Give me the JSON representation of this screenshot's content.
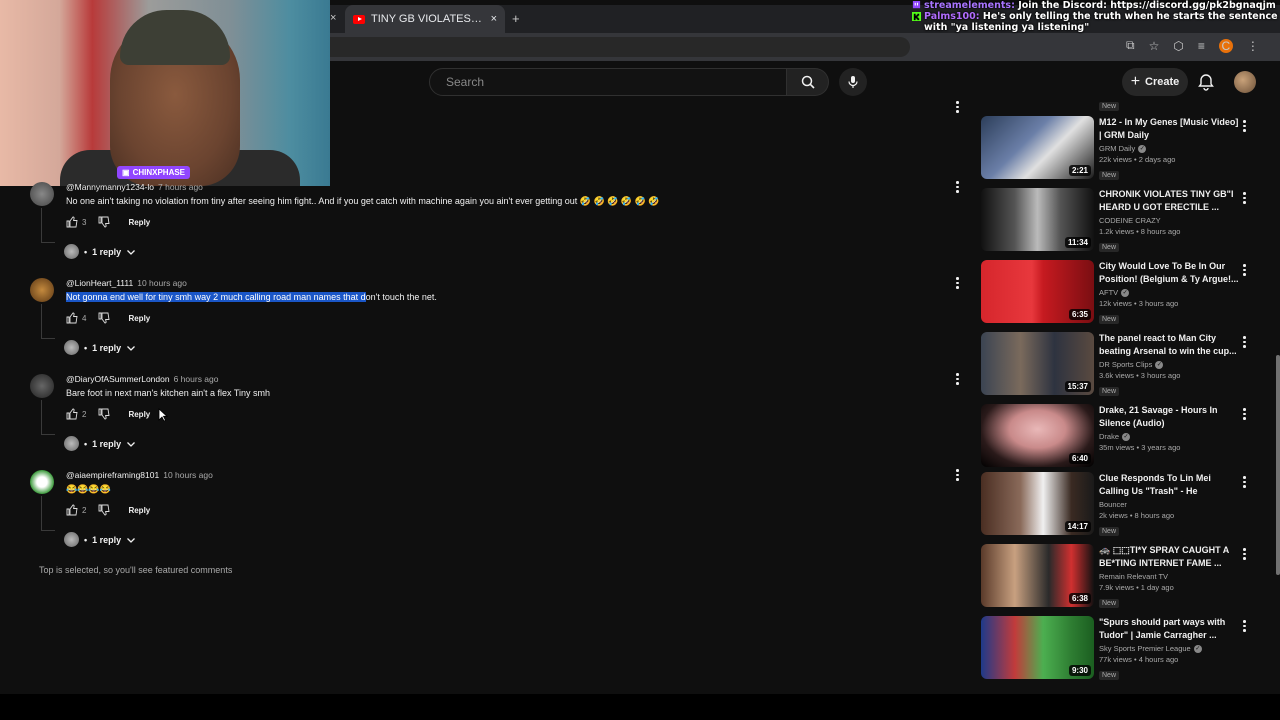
{
  "browser": {
    "tab_title": "TINY GB VIOLATES JUSTO,PINK",
    "tab_close": "×",
    "new_tab": "+",
    "profile_initial": "C"
  },
  "chat_overlay": {
    "messages": [
      {
        "user": "streamelements:",
        "text": "Join the Discord: https://discord.gg/pk2bgnaqjm"
      },
      {
        "user": "Palms100:",
        "text": "He's only telling the truth when he starts the sentence with \"ya listening ya listening\""
      }
    ]
  },
  "webcam": {
    "tag": "CHINXPHASE"
  },
  "masthead": {
    "search_placeholder": "Search",
    "create_label": "Create"
  },
  "comments": [
    {
      "author": "@Mannymanny1234-lo",
      "ago": "7 hours ago",
      "text": "No one ain't taking no violation from tiny after seeing him fight.. And if you get catch with machine again you ain't ever getting out 🤣 🤣 🤣 🤣 🤣 🤣",
      "likes": "3",
      "reply_label": "Reply",
      "replies_label": "1 reply"
    },
    {
      "author": "@LionHeart_1111",
      "ago": "10 hours ago",
      "text_highlighted": "Not gonna end well for tiny smh way 2 much calling road man names that d",
      "text_rest": "on't touch the net.",
      "likes": "4",
      "reply_label": "Reply",
      "replies_label": "1 reply"
    },
    {
      "author": "@DiaryOfASummerLondon",
      "ago": "6 hours ago",
      "text": "Bare foot in next man's kitchen ain't a flex Tiny smh",
      "likes": "2",
      "reply_label": "Reply",
      "replies_label": "1 reply"
    },
    {
      "author": "@aiaempireframing8101",
      "ago": "10 hours ago",
      "text": "😂😂😂😂",
      "likes": "2",
      "reply_label": "Reply",
      "replies_label": "1 reply"
    }
  ],
  "featured_note": "Top is selected, so you'll see featured comments",
  "sidebar": {
    "top_new": "New",
    "videos": [
      {
        "title": "M12 - In My Genes [Music Video] | GRM Daily",
        "channel": "GRM Daily",
        "verified": true,
        "meta": "22k views • 2 days ago",
        "badge": "New",
        "duration": "2:21"
      },
      {
        "title": "CHRONIK VIOLATES TINY GB\"I HEARD U GOT ERECTILE ...",
        "channel": "CODEINE CRAZY",
        "verified": false,
        "meta": "1.2k views • 8 hours ago",
        "badge": "New",
        "duration": "11:34"
      },
      {
        "title": "City Would Love To Be In Our Position! (Belgium & Ty Argue!...",
        "channel": "AFTV",
        "verified": true,
        "meta": "12k views • 3 hours ago",
        "badge": "New",
        "duration": "6:35"
      },
      {
        "title": "The panel react to Man City beating Arsenal to win the cup...",
        "channel": "DR Sports Clips",
        "verified": true,
        "meta": "3.6k views • 3 hours ago",
        "badge": "New",
        "duration": "15:37"
      },
      {
        "title": "Drake, 21 Savage - Hours In Silence (Audio)",
        "channel": "Drake",
        "verified": true,
        "meta": "35m views • 3 years ago",
        "badge": "",
        "duration": "6:40"
      },
      {
        "title": "Clue Responds To Lin Mei Calling Us \"Trash\" - He Doesn't...",
        "channel": "Bouncer",
        "verified": false,
        "meta": "2k views • 8 hours ago",
        "badge": "New",
        "duration": "14:17"
      },
      {
        "title": "🚓 ⬚⬚TI*Y SPRAY CAUGHT A BE*TING  INTERNET FAME ...",
        "channel": "Remain Relevant TV",
        "verified": false,
        "meta": "7.9k views • 1 day ago",
        "badge": "New",
        "duration": "6:38"
      },
      {
        "title": "\"Spurs should part ways with Tudor\" | Jamie Carragher ...",
        "channel": "Sky Sports Premier League",
        "verified": true,
        "meta": "77k views • 4 hours ago",
        "badge": "New",
        "duration": "9:30"
      }
    ]
  }
}
